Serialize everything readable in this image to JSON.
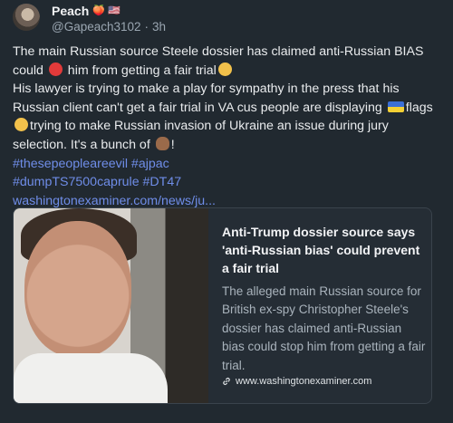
{
  "post": {
    "author": {
      "display_name": "Peach",
      "name_emojis": "🍑 🇺🇸",
      "handle": "@Gapeach3102",
      "separator": "·",
      "time": "3h"
    },
    "lines": [
      {
        "parts": [
          {
            "t": "The main Russian source Steele dossier has claimed anti-Russian BIAS"
          }
        ]
      },
      {
        "parts": [
          {
            "t": "could "
          },
          {
            "emoji": "stop-emoji"
          },
          {
            "t": " him from getting a fair trial"
          },
          {
            "emoji": "smirk-emoji"
          }
        ]
      },
      {
        "parts": [
          {
            "t": "His lawyer is trying to make a play for sympathy in the press that his"
          }
        ]
      },
      {
        "parts": [
          {
            "t": "Russian client can't get a fair trial in VA cus people are displaying "
          },
          {
            "emoji": "flag-emoji"
          },
          {
            "t": "flags"
          }
        ]
      },
      {
        "parts": [
          {
            "emoji": "roll-emoji"
          },
          {
            "t": "trying to make Russian invasion of Ukraine an issue during jury"
          }
        ]
      },
      {
        "parts": [
          {
            "t": "selection. It's a bunch of "
          },
          {
            "emoji": "poo-emoji"
          },
          {
            "t": "!"
          }
        ]
      },
      {
        "parts": [
          {
            "t": "#thesepeopleareevil #ajpac",
            "link": true
          }
        ]
      },
      {
        "parts": [
          {
            "t": "#dumpTS7500caprule #DT47",
            "link": true
          }
        ]
      },
      {
        "parts": [
          {
            "t": "washingtonexaminer.com/news/ju...",
            "link": true
          }
        ]
      }
    ],
    "link_card": {
      "title": "Anti-Trump dossier source says 'anti-Russian bias' could prevent a fair trial",
      "description": "The alleged main Russian source for British ex-spy Christopher Steele's dossier has claimed anti-Russian bias could stop him from getting a fair trial.",
      "domain": "www.washingtonexaminer.com",
      "domain_icon": "link-icon"
    }
  },
  "colors": {
    "background": "#212930",
    "link": "#6f8de8",
    "muted": "#9aa6b1"
  }
}
